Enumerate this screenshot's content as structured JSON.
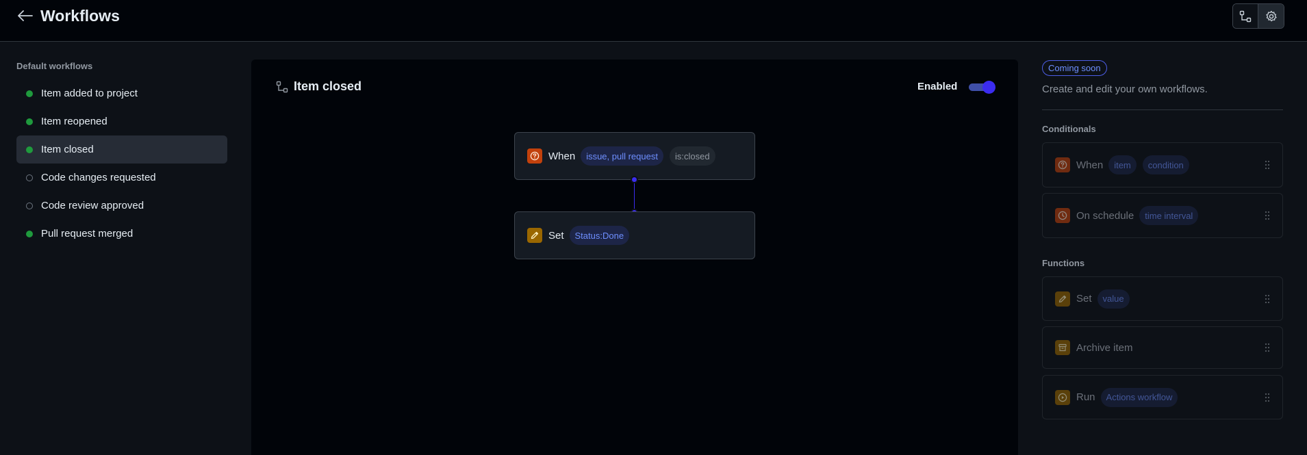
{
  "header": {
    "title": "Workflows",
    "icons": {
      "back": "arrow-left-icon",
      "workflow_view": "workflow-icon",
      "settings": "gear-icon"
    }
  },
  "sidebar": {
    "heading": "Default workflows",
    "items": [
      {
        "label": "Item added to project",
        "enabled": true
      },
      {
        "label": "Item reopened",
        "enabled": true
      },
      {
        "label": "Item closed",
        "enabled": true,
        "selected": true
      },
      {
        "label": "Code changes requested",
        "enabled": false
      },
      {
        "label": "Code review approved",
        "enabled": false
      },
      {
        "label": "Pull request merged",
        "enabled": true
      }
    ]
  },
  "canvas": {
    "title": "Item closed",
    "enabled_label": "Enabled",
    "enabled": true,
    "trigger": {
      "label": "When",
      "pills": [
        "issue, pull request",
        "is:closed"
      ]
    },
    "action": {
      "label": "Set",
      "pills": [
        "Status:Done"
      ]
    }
  },
  "right_panel": {
    "badge": "Coming soon",
    "description": "Create and edit your own workflows.",
    "conditionals_heading": "Conditionals",
    "conditionals": [
      {
        "label": "When",
        "pills": [
          "item",
          "condition"
        ],
        "icon": "question-icon"
      },
      {
        "label": "On schedule",
        "pills": [
          "time interval"
        ],
        "icon": "clock-icon"
      }
    ],
    "functions_heading": "Functions",
    "functions": [
      {
        "label": "Set",
        "pills": [
          "value"
        ],
        "icon": "pencil-icon"
      },
      {
        "label": "Archive item",
        "pills": [],
        "icon": "archive-icon"
      },
      {
        "label": "Run",
        "pills": [
          "Actions workflow"
        ],
        "icon": "play-icon"
      }
    ]
  },
  "colors": {
    "background": "#0d1117",
    "header": "#010409",
    "accent": "#3b2cf0",
    "enabled_dot": "#1f9a3d",
    "trigger_icon": "#c2410c",
    "function_icon": "#9a6700"
  }
}
